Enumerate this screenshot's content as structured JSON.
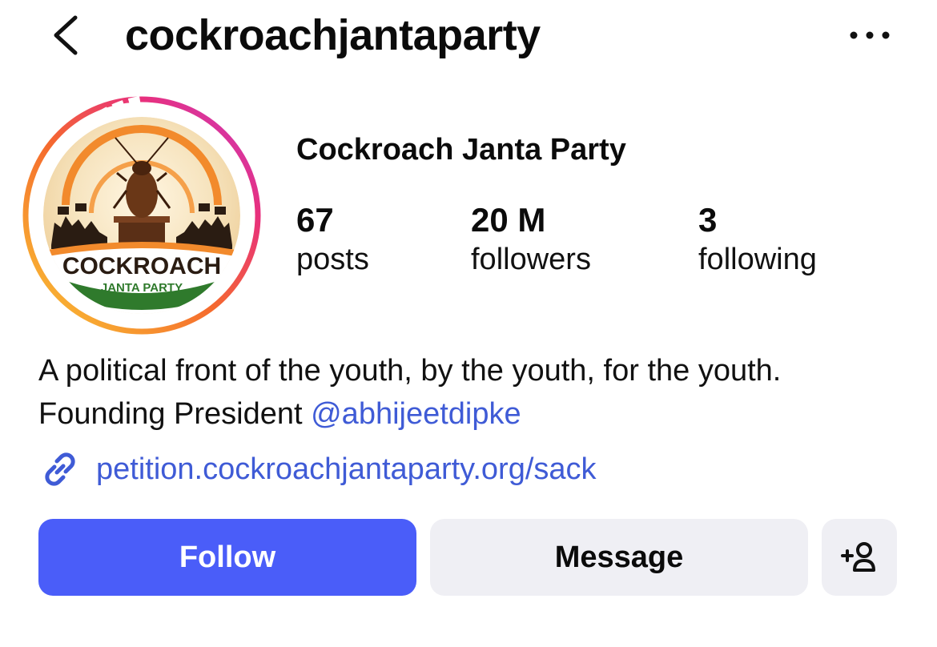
{
  "header": {
    "username": "cockroachjantaparty"
  },
  "profile": {
    "display_name": "Cockroach Janta Party",
    "avatar_logo_text": [
      "COCKROACH",
      "JANTA PARTY"
    ],
    "stats": {
      "posts": {
        "value": "67",
        "label": "posts"
      },
      "followers": {
        "value": "20 M",
        "label": "followers"
      },
      "following": {
        "value": "3",
        "label": "following"
      }
    },
    "bio": {
      "text": "A political front of the youth, by the youth, for the youth. Founding President ",
      "mention": "@abhijeetdipke"
    },
    "link": {
      "icon": "link-icon",
      "text": "petition.cockroachjantaparty.org/sack"
    }
  },
  "actions": {
    "follow_label": "Follow",
    "message_label": "Message",
    "add_user_icon": "add-person-icon"
  },
  "colors": {
    "follow_button": "#4a5df9",
    "secondary_button": "#efeff4",
    "link": "#3f5bd6",
    "story_ring": [
      "#f9c934",
      "#f56a2d",
      "#e8307c",
      "#c53bc8"
    ]
  }
}
